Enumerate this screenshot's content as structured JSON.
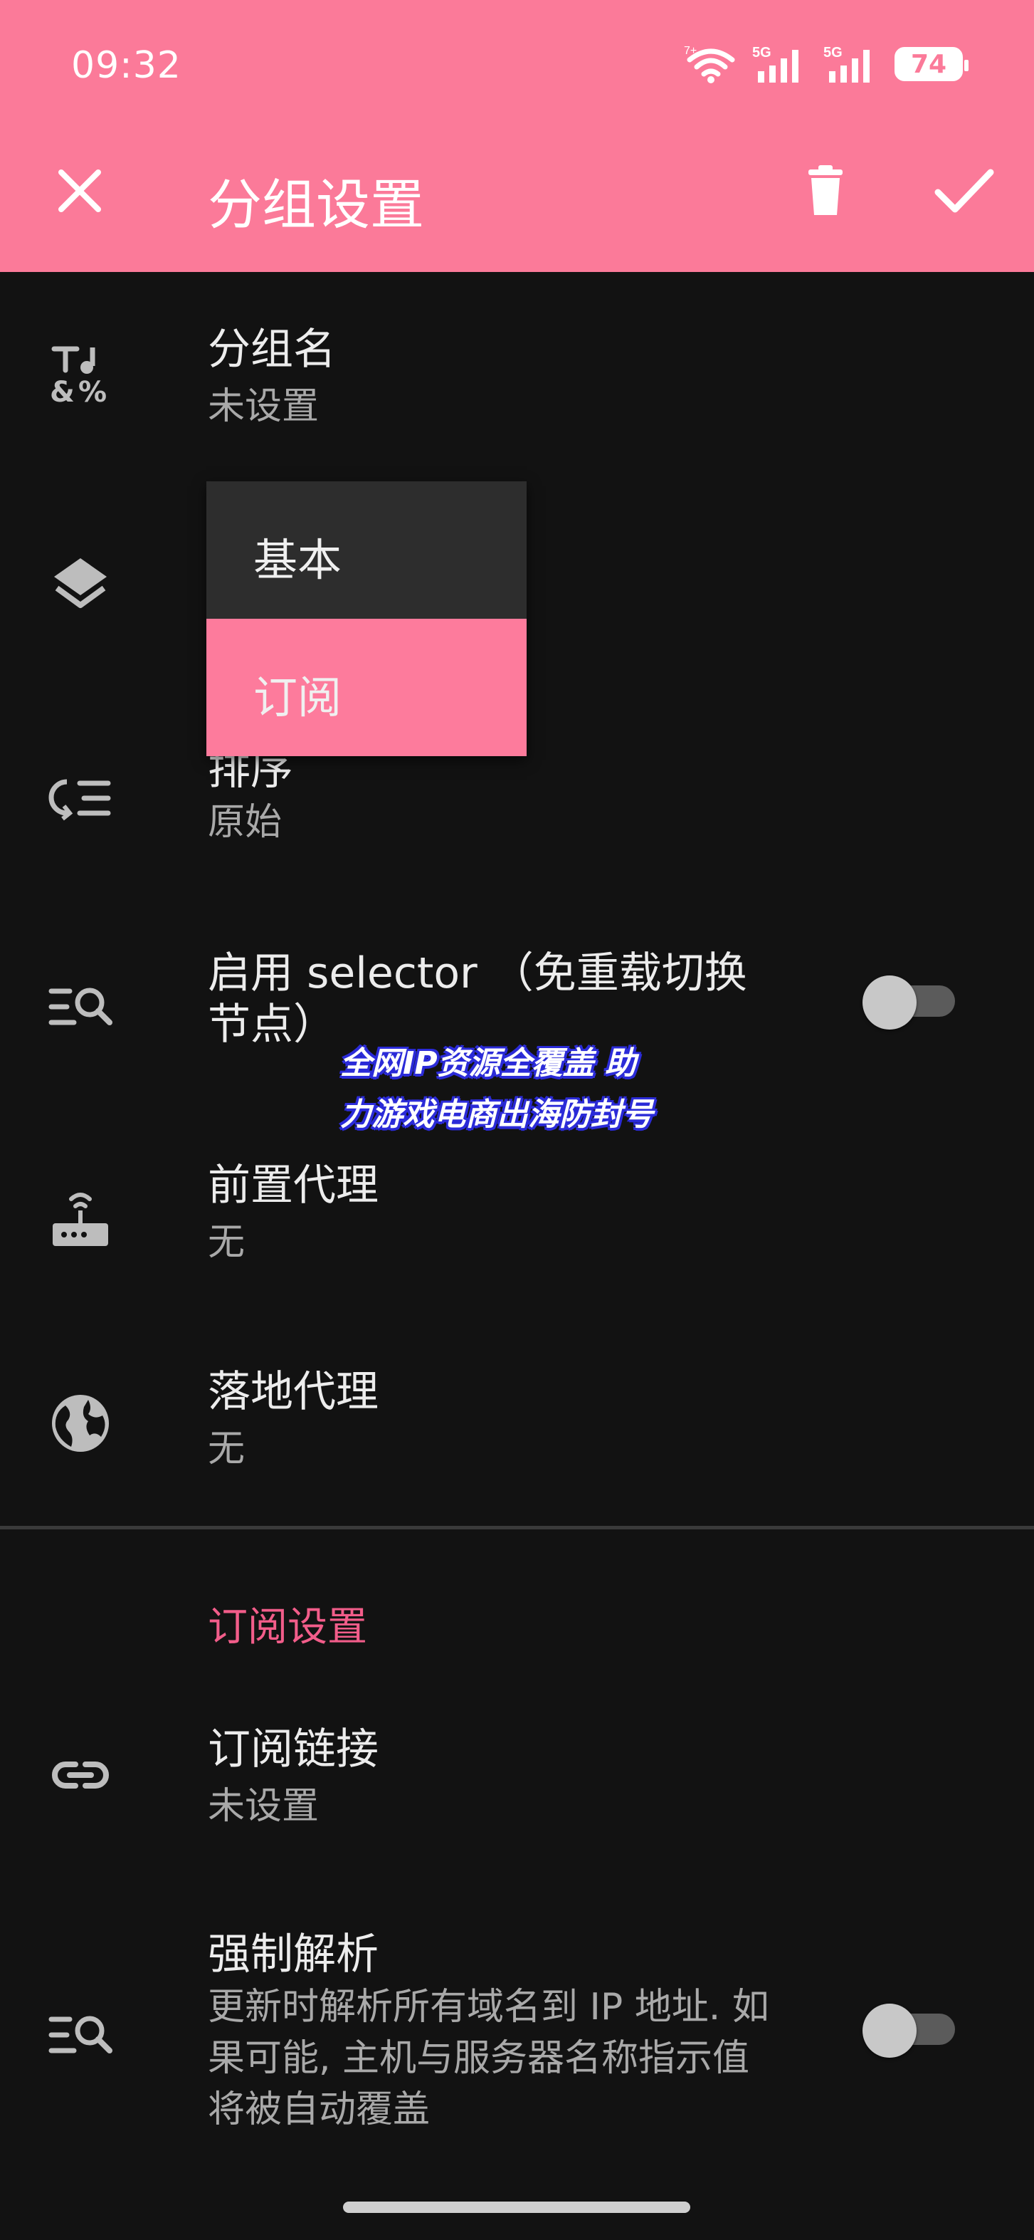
{
  "status_bar": {
    "time": "09:32",
    "battery": "74",
    "wifi_label": "7+",
    "signal1_label": "5G",
    "signal2_label": "5G"
  },
  "app_bar": {
    "title": "分组设置",
    "icons": [
      "close-icon",
      "delete-icon",
      "check-icon"
    ]
  },
  "rows": {
    "group_name": {
      "title": "分组名",
      "subtitle": "未设置",
      "icon": "music-note-percent-icon"
    },
    "group_type": {
      "icon": "layers-icon"
    },
    "sort": {
      "title": "排序",
      "subtitle": "原始",
      "icon": "sort-icon"
    },
    "selector": {
      "title_line1": "启用 selector （免重载切换",
      "title_line2": "节点）",
      "icon": "search-list-icon",
      "enabled": false
    },
    "front_proxy": {
      "title": "前置代理",
      "subtitle": "无",
      "icon": "router-icon"
    },
    "landing_proxy": {
      "title": "落地代理",
      "subtitle": "无",
      "icon": "globe-icon"
    }
  },
  "section": {
    "header": "订阅设置"
  },
  "subscription": {
    "link": {
      "title": "订阅链接",
      "subtitle": "未设置",
      "icon": "link-icon"
    },
    "force_resolve": {
      "title": "强制解析",
      "desc_line1": "更新时解析所有域名到 IP 地址. 如",
      "desc_line2": "果可能, 主机与服务器名称指示值",
      "desc_line3": "将被自动覆盖",
      "icon": "search-list-icon",
      "enabled": false
    }
  },
  "dropdown": {
    "options": [
      "基本",
      "订阅"
    ],
    "selected": "订阅"
  },
  "overlay": {
    "line1": "全网IP资源全覆盖 助",
    "line2": "力游戏电商出海防封号"
  },
  "colors": {
    "accent": "#fb7a99",
    "section_header": "#f25d8a",
    "background": "#121212"
  }
}
